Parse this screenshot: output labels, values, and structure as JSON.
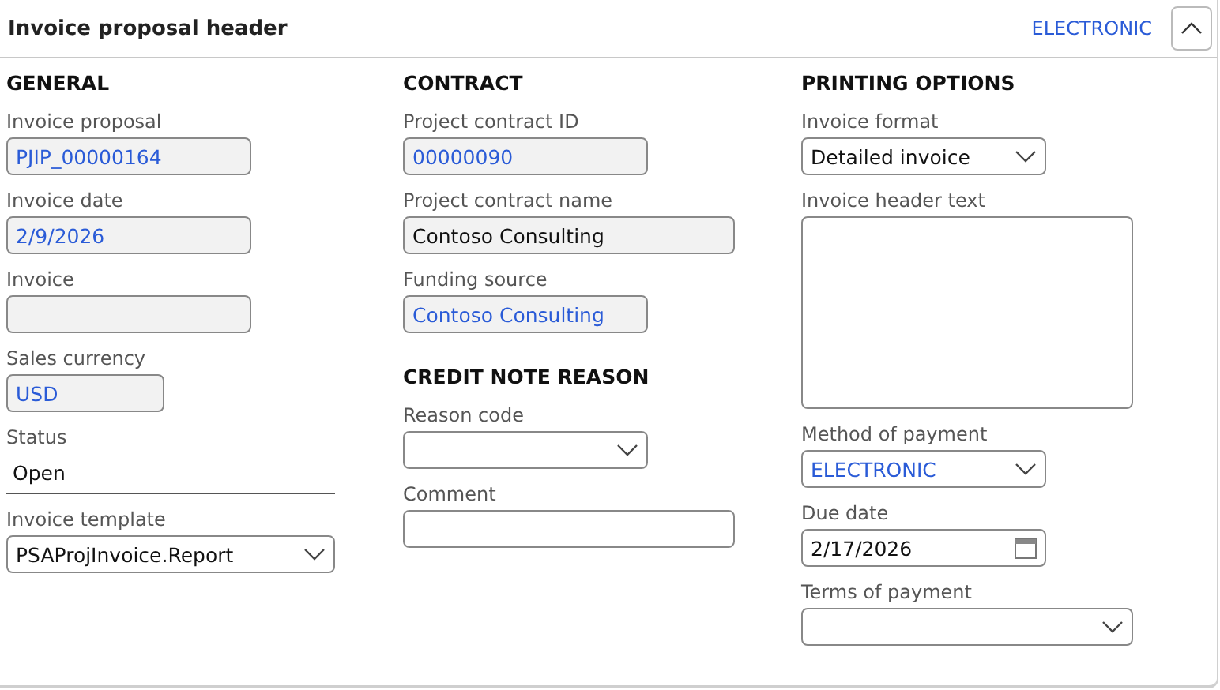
{
  "header": {
    "title": "Invoice proposal header",
    "summary": "ELECTRONIC",
    "expanded": true
  },
  "columns": [
    {
      "sections": [
        {
          "title": "GENERAL",
          "fields": [
            {
              "label": "Invoice proposal",
              "kind": "readonly",
              "value": "PJIP_00000164",
              "link": true
            },
            {
              "label": "Invoice date",
              "kind": "readonly",
              "value": "2/9/2026",
              "link": true
            },
            {
              "label": "Invoice",
              "kind": "readonly"
            },
            {
              "label": "Sales currency",
              "kind": "readonly",
              "value": "USD",
              "link": true
            },
            {
              "label": "Status",
              "kind": "static",
              "value": "Open"
            },
            {
              "label": "Invoice template",
              "kind": "select",
              "value": "PSAProjInvoice.Report",
              "link": false
            }
          ]
        }
      ]
    },
    {
      "sections": [
        {
          "title": "CONTRACT",
          "fields": [
            {
              "label": "Project contract ID",
              "kind": "readonly",
              "value": "00000090",
              "link": true
            },
            {
              "label": "Project contract name",
              "kind": "readonly",
              "value": "Contoso Consulting",
              "link": false
            },
            {
              "label": "Funding source",
              "kind": "readonly",
              "value": "Contoso Consulting",
              "link": true
            }
          ]
        },
        {
          "title": "CREDIT NOTE REASON",
          "fields": [
            {
              "label": "Reason code",
              "kind": "select"
            },
            {
              "label": "Comment",
              "kind": "text"
            }
          ]
        }
      ]
    },
    {
      "sections": [
        {
          "title": "PRINTING OPTIONS",
          "fields": [
            {
              "label": "Invoice format",
              "kind": "select",
              "value": "Detailed invoice",
              "link": false
            },
            {
              "label": "Invoice header text",
              "kind": "textarea"
            },
            {
              "label": "Method of payment",
              "kind": "select",
              "value": "ELECTRONIC",
              "link": true
            },
            {
              "label": "Due date",
              "kind": "date",
              "value": "2/17/2026"
            },
            {
              "label": "Terms of payment",
              "kind": "select"
            }
          ]
        }
      ]
    }
  ]
}
